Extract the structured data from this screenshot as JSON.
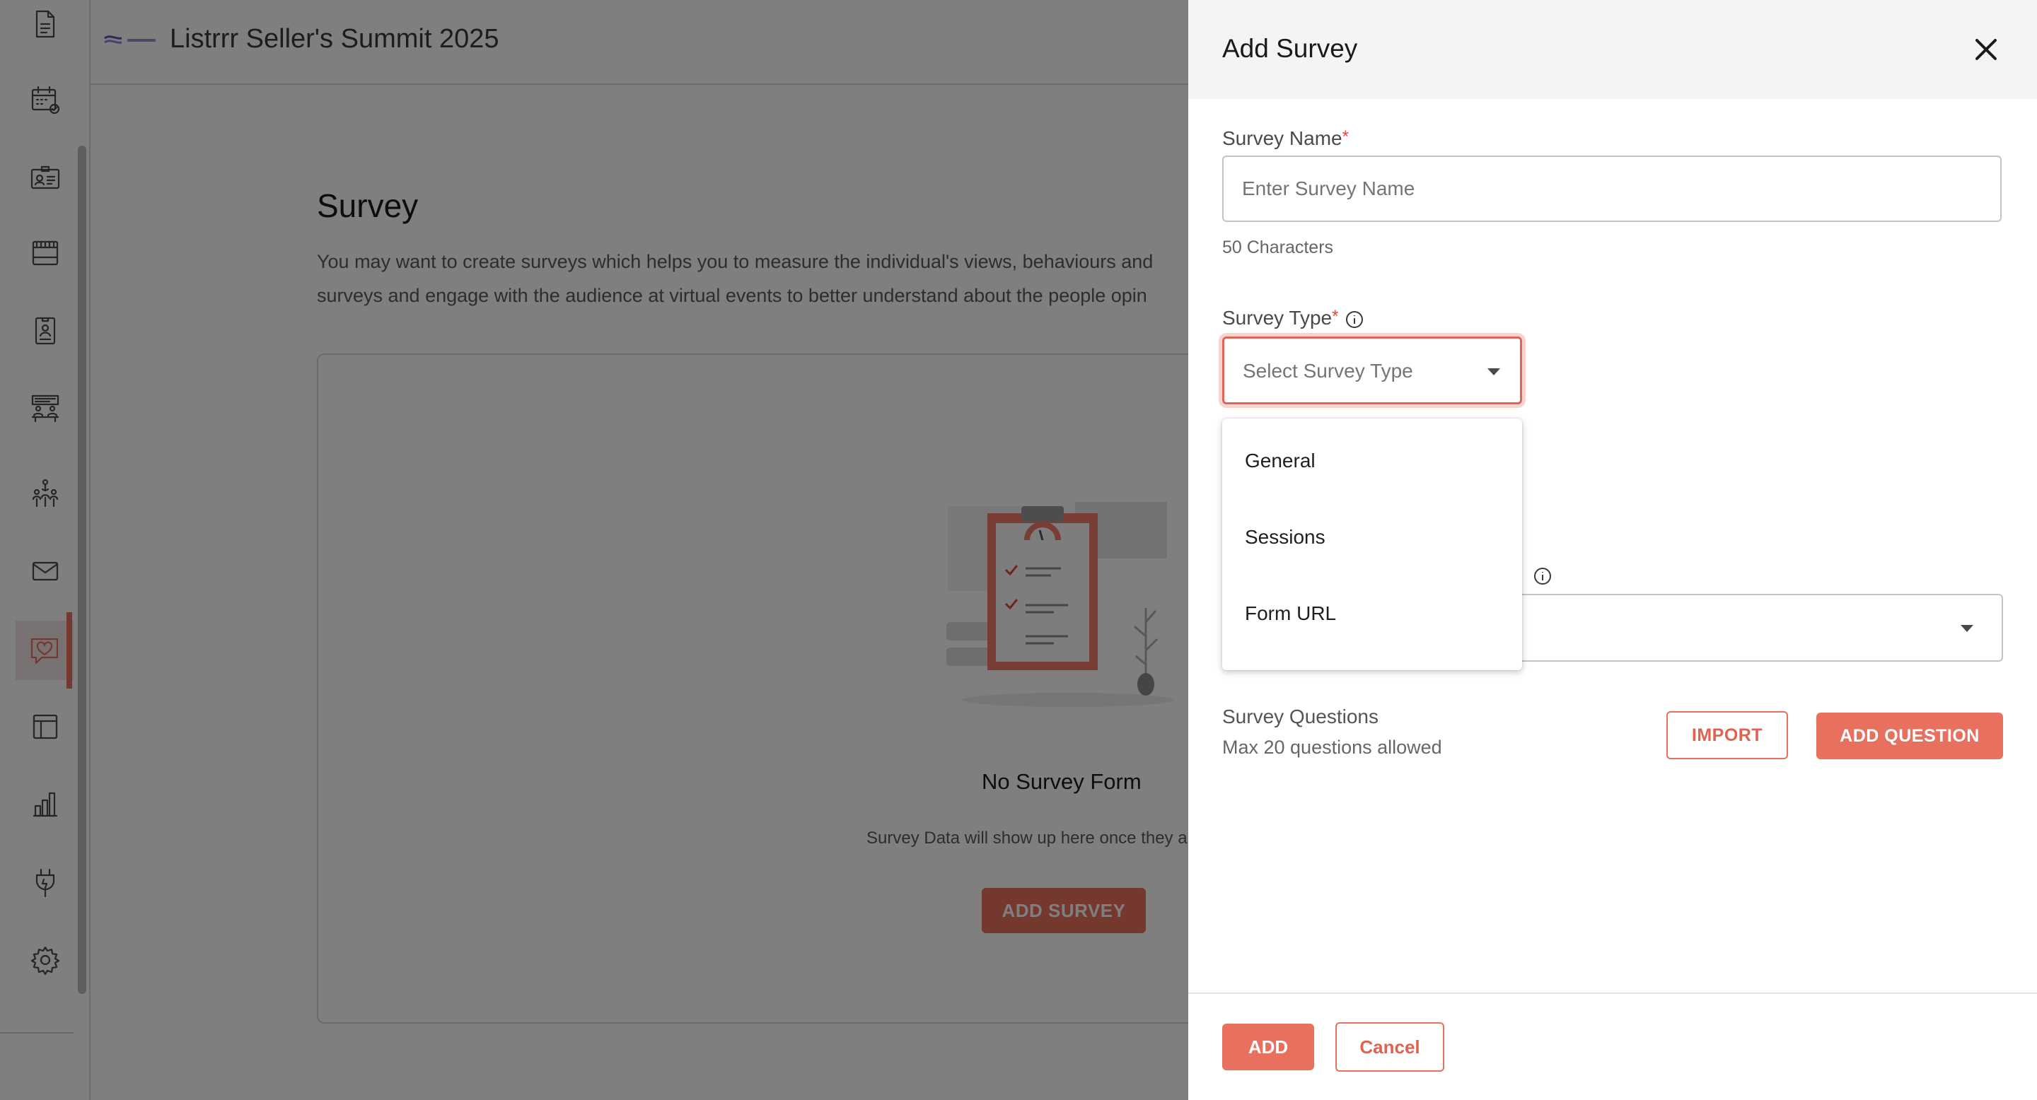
{
  "app": {
    "event_title": "Listrrr Seller's Summit 2025",
    "sidebar": {
      "items": [
        {
          "icon": "document-icon"
        },
        {
          "icon": "calendar-check-icon"
        },
        {
          "icon": "id-card-icon"
        },
        {
          "icon": "booth-icon"
        },
        {
          "icon": "badge-icon"
        },
        {
          "icon": "meeting-icon"
        },
        {
          "icon": "networking-icon"
        },
        {
          "icon": "mail-icon"
        },
        {
          "icon": "survey-heart-icon",
          "active": true
        },
        {
          "icon": "layout-icon"
        },
        {
          "icon": "analytics-icon"
        },
        {
          "icon": "integration-plug-icon"
        },
        {
          "icon": "settings-gear-icon"
        }
      ]
    },
    "page": {
      "title": "Survey",
      "description_line1": "You may want to create surveys which helps you to measure the individual's views, behaviours and",
      "description_line2": "surveys and engage with the audience at virtual events to better understand about the people opin",
      "empty_title": "No Survey Form",
      "empty_desc": "Survey Data will show up here once they a",
      "add_survey_label": "ADD SURVEY"
    }
  },
  "drawer": {
    "title": "Add Survey",
    "survey_name": {
      "label": "Survey Name",
      "required_mark": "*",
      "placeholder": "Enter Survey Name",
      "value": "",
      "hint": "50 Characters"
    },
    "survey_type": {
      "label": "Survey Type",
      "required_mark": "*",
      "placeholder": "Select Survey Type",
      "options": [
        "General",
        "Sessions",
        "Form URL"
      ]
    },
    "questions": {
      "title": "Survey Questions",
      "subtitle": "Max 20 questions allowed",
      "import_label": "IMPORT",
      "add_question_label": "ADD QUESTION"
    },
    "footer": {
      "add_label": "ADD",
      "cancel_label": "Cancel"
    }
  },
  "colors": {
    "accent": "#e8705f",
    "required": "#e0493a",
    "overlay": "rgba(0,0,0,0.5)"
  }
}
